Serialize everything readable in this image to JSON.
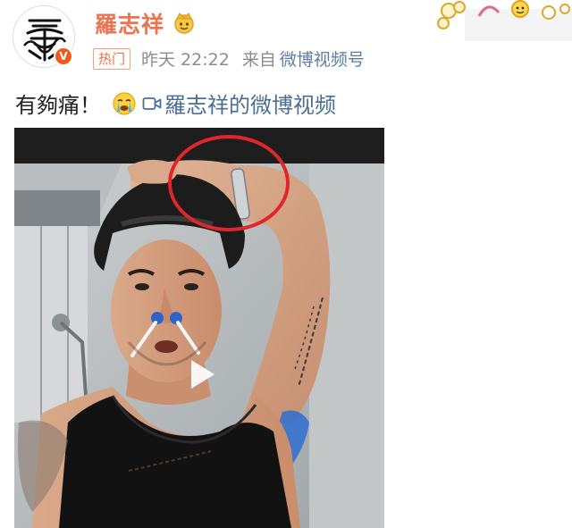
{
  "user": {
    "name": "羅志祥",
    "verified_mark": "V"
  },
  "meta": {
    "tag": "热门",
    "time": "昨天 22:22",
    "source_prefix": "来自",
    "source": "微博视频号"
  },
  "post": {
    "text": "有夠痛！",
    "video_link": "羅志祥的微博视频"
  },
  "icons": {
    "crown": "crown-icon",
    "cry": "crying-emoji-icon",
    "video": "video-camera-icon",
    "play": "play-icon"
  },
  "colors": {
    "username": "#eb7350",
    "link": "#4b6e93",
    "annotation_circle": "#e0262a"
  }
}
